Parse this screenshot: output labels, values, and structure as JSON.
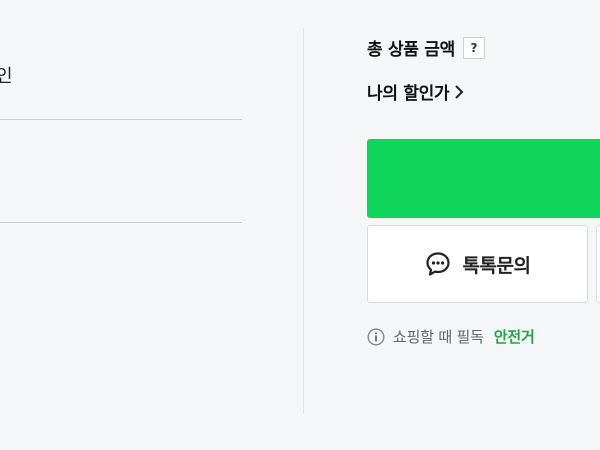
{
  "left": {
    "partial_char": "인"
  },
  "summary": {
    "total_label": "총 상품 금액",
    "help_label": "?"
  },
  "discount": {
    "label": "나의 할인가"
  },
  "talk": {
    "label": "톡톡문의"
  },
  "notice": {
    "text": "쇼핑할 때 필독",
    "link": "안전거"
  },
  "colors": {
    "buy_button": "#0fd65a",
    "safe_link": "#21a646",
    "background": "#f5f6f8"
  },
  "icons": {
    "help": "question-mark-icon",
    "discount_chevron": "chevron-right-icon",
    "talk": "chat-bubble-icon",
    "notice": "info-icon"
  }
}
